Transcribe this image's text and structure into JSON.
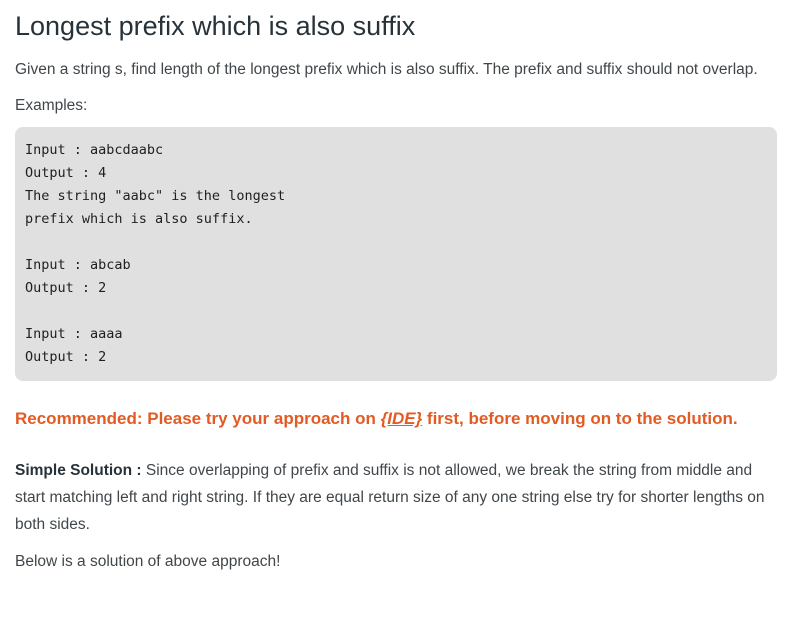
{
  "article": {
    "title": "Longest prefix which is also suffix",
    "intro": "Given a string s, find length of the longest prefix which is also suffix. The prefix and suffix should not overlap.",
    "examples_label": "Examples:",
    "code_lines": [
      "Input : aabcdaabc",
      "Output : 4",
      "The string \"aabc\" is the longest",
      "prefix which is also suffix.",
      "",
      "Input : abcab",
      "Output : 2",
      "",
      "Input : aaaa",
      "Output : 2"
    ],
    "recommended": {
      "prefix": "Recommended: Please try your approach on ",
      "link_text": "{IDE}",
      "suffix": " first, before moving on to the solution."
    },
    "solution": {
      "label": "Simple Solution :",
      "text": " Since overlapping of prefix and suffix is not allowed, we break the string from middle and start matching left and right string. If they are equal return size of any one string else try for shorter lengths on both sides."
    },
    "below_text": "Below is a solution of above approach!"
  },
  "colors": {
    "accent": "#e25b24",
    "code_background": "#e0e0e0",
    "text": "#40464a"
  }
}
